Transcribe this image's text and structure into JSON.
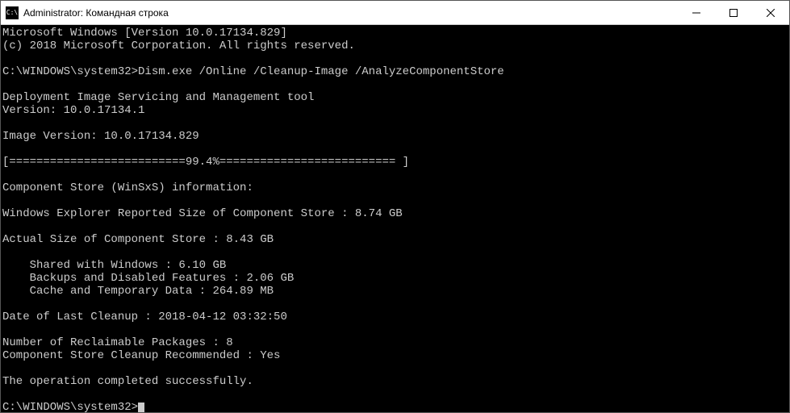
{
  "titlebar": {
    "icon_label": "C:\\",
    "title": "Administrator: Командная строка"
  },
  "terminal": {
    "banner_line1": "Microsoft Windows [Version 10.0.17134.829]",
    "banner_line2": "(c) 2018 Microsoft Corporation. All rights reserved.",
    "prompt1_path": "C:\\WINDOWS\\system32>",
    "prompt1_cmd": "Dism.exe /Online /Cleanup-Image /AnalyzeComponentStore",
    "tool_header": "Deployment Image Servicing and Management tool",
    "tool_version": "Version: 10.0.17134.1",
    "image_version": "Image Version: 10.0.17134.829",
    "progress": "[==========================99.4%========================== ]",
    "section_header": "Component Store (WinSxS) information:",
    "reported_size": "Windows Explorer Reported Size of Component Store : 8.74 GB",
    "actual_size": "Actual Size of Component Store : 8.43 GB",
    "shared": "    Shared with Windows : 6.10 GB",
    "backups": "    Backups and Disabled Features : 2.06 GB",
    "cache": "    Cache and Temporary Data : 264.89 MB",
    "last_cleanup": "Date of Last Cleanup : 2018-04-12 03:32:50",
    "reclaimable": "Number of Reclaimable Packages : 8",
    "recommended": "Component Store Cleanup Recommended : Yes",
    "success": "The operation completed successfully.",
    "prompt2_path": "C:\\WINDOWS\\system32>"
  }
}
